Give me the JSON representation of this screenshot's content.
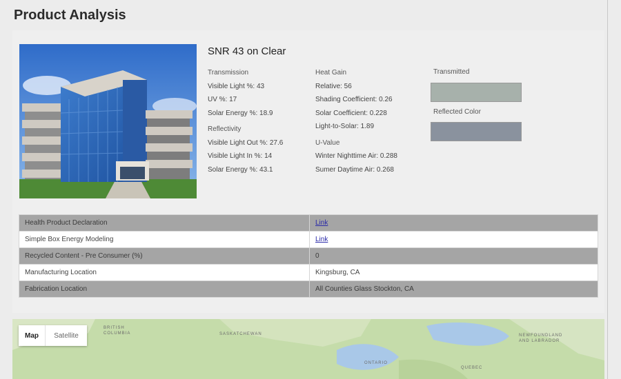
{
  "page": {
    "title": "Product Analysis"
  },
  "product": {
    "name": "SNR 43 on Clear",
    "transmission": {
      "heading": "Transmission",
      "visible_light": "Visible Light %: 43",
      "uv": "UV %: 17",
      "solar_energy": "Solar Energy %: 18.9"
    },
    "reflectivity": {
      "heading": "Reflectivity",
      "visible_light_out": "Visible Light Out %: 27.6",
      "visible_light_in": "Visible Light In %: 14",
      "solar_energy": "Solar Energy %: 43.1"
    },
    "heat_gain": {
      "heading": "Heat Gain",
      "relative": "Relative: 56",
      "shading_coefficient": "Shading Coefficient: 0.26",
      "solar_coefficient": "Solar Coefficient: 0.228",
      "light_to_solar": "Light-to-Solar: 1.89"
    },
    "u_value": {
      "heading": "U-Value",
      "winter": "Winter Nighttime Air: 0.288",
      "summer": "Sumer Daytime Air: 0.268"
    },
    "colors": {
      "transmitted_label": "Transmitted",
      "transmitted_color": "#a7b1ab",
      "reflected_label": "Reflected Color",
      "reflected_color": "#8a929e"
    }
  },
  "table": [
    {
      "label": "Health Product Declaration",
      "value": "Link",
      "is_link": true
    },
    {
      "label": "Simple Box Energy Modeling",
      "value": "Link",
      "is_link": true
    },
    {
      "label": "Recycled Content - Pre Consumer (%)",
      "value": "0",
      "is_link": false
    },
    {
      "label": "Manufacturing Location",
      "value": "Kingsburg, CA",
      "is_link": false
    },
    {
      "label": "Fabrication Location",
      "value": "All Counties Glass Stockton, CA",
      "is_link": false
    }
  ],
  "map": {
    "tab_map": "Map",
    "tab_satellite": "Satellite",
    "labels": [
      "BRITISH",
      "COLUMBIA",
      "SASKATCHEWAN",
      "ONTARIO",
      "QUEBEC",
      "NEWFOUNDLAND",
      "AND LABRADOR"
    ]
  }
}
